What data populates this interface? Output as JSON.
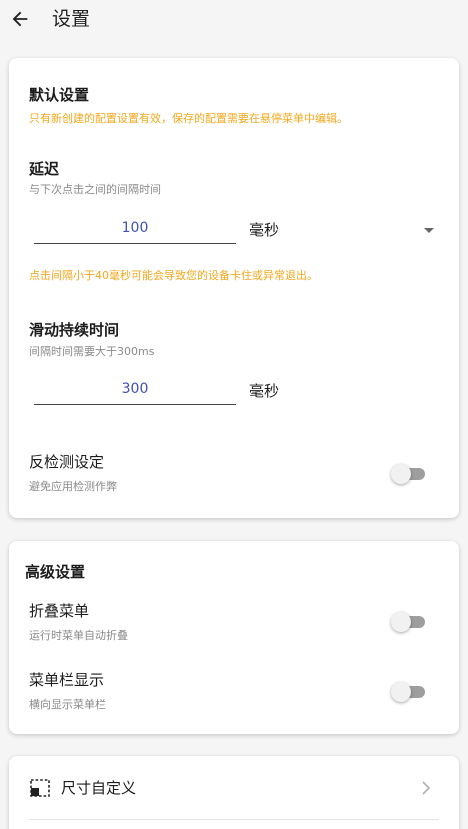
{
  "header": {
    "title": "设置",
    "back_icon": "arrow-left-icon"
  },
  "default_settings": {
    "title": "默认设置",
    "notice": "只有新创建的配置设置有效，保存的配置需要在悬停菜单中编辑。",
    "delay": {
      "label": "延迟",
      "description": "与下次点击之间的间隔时间",
      "value": "100",
      "unit": "毫秒",
      "warning": "点击间隔小于40毫秒可能会导致您的设备卡住或异常退出。"
    },
    "swipe_duration": {
      "label": "滑动持续时间",
      "description": "间隔时间需要大于300ms",
      "value": "300",
      "unit": "毫秒"
    },
    "anti_detection": {
      "label": "反检测设定",
      "description": "避免应用检测作弊",
      "enabled": false
    }
  },
  "advanced_settings": {
    "title": "高级设置",
    "collapse_menu": {
      "label": "折叠菜单",
      "description": "运行时菜单自动折叠",
      "enabled": false
    },
    "menubar_display": {
      "label": "菜单栏显示",
      "description": "横向显示菜单栏",
      "enabled": false
    }
  },
  "custom_size": {
    "label": "尺寸自定义",
    "icon": "resize-frame-icon"
  },
  "colors": {
    "accent": "#3f51b5",
    "warning": "#f2a81e",
    "switch_off_track": "#9e9e9e"
  }
}
